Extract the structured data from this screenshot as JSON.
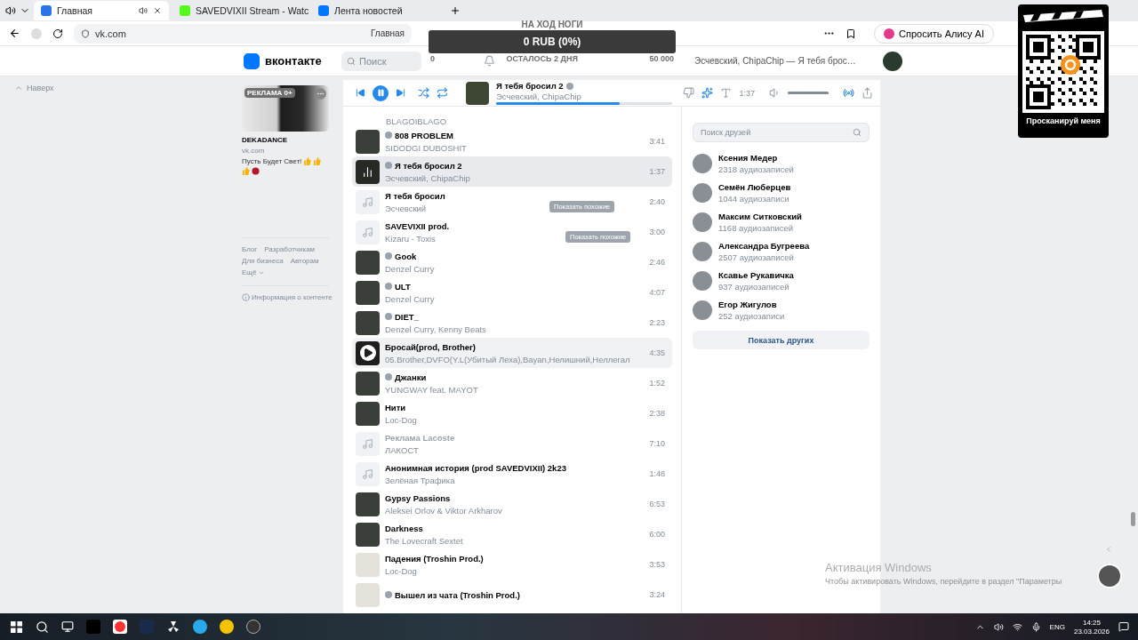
{
  "browser": {
    "tabs": [
      {
        "kind": "video",
        "title": "Главная",
        "selected": true,
        "audio": true
      },
      {
        "kind": "stream",
        "title": "SAVEDVIXII Stream - Watc",
        "selected": false,
        "audio": false
      },
      {
        "kind": "vk",
        "title": "Лента новостей",
        "selected": false,
        "audio": false
      }
    ],
    "url": "vk.com",
    "page_title": "Главная",
    "assistant_button": "Спросить Алису AI"
  },
  "stream_overlay": {
    "caption": "НА ХОД НОГИ",
    "amount": "0 RUB (0%)",
    "remaining": "ОСТАЛОСЬ 2 ДНЯ",
    "start": "0",
    "goal": "50 000",
    "level": 0
  },
  "qr_overlay": {
    "caption": "Просканируй меня"
  },
  "header": {
    "logo": "вконтакте",
    "search_placeholder": "Поиск",
    "now_playing": "Эсчевский, ChipaChip — Я тебя брос…"
  },
  "left_nav": {
    "back_to_top": "Наверх"
  },
  "ad": {
    "badge": "РЕКЛАМА 0+",
    "title": "DEKADANCE",
    "domain": "vk.com",
    "text": "Пусть Будет Свет!"
  },
  "footer_links": [
    "Блог",
    "Разработчикам",
    "Для бизнеса",
    "Авторам"
  ],
  "footer_more": "Ещё",
  "content_info": "Информация о контенте",
  "player": {
    "title": "Я тебя бросил 2",
    "artist": "Эсчевский, ChipaChip",
    "explicit": true,
    "playing": true,
    "time": "1:37",
    "progress": {
      "level": 0.7
    },
    "volume": {
      "level": 1
    }
  },
  "tracks": [
    {
      "kind": "partial",
      "artist": "BLAGOIBLAGO"
    },
    {
      "kind": "photo",
      "title": "808 PROBLEM",
      "artist": "SIDODGI DUBOSHIT",
      "time": "3:41",
      "explicit": true,
      "selected": false,
      "hovered": false,
      "disabled": false
    },
    {
      "kind": "playing",
      "title": "Я тебя бросил 2",
      "artist": "Эсчевский, ChipaChip",
      "time": "1:37",
      "explicit": true,
      "selected": true,
      "hovered": false,
      "disabled": false
    },
    {
      "kind": "note",
      "title": "Я тебя бросил",
      "artist": "Эсчевский",
      "time": "2:40",
      "explicit": false,
      "selected": false,
      "hovered": false,
      "disabled": false,
      "tooltip": "Показать похожие"
    },
    {
      "kind": "note",
      "title": "SAVEVIXII prod.",
      "artist": "Kizaru - Toxis",
      "time": "3:00",
      "explicit": false,
      "selected": false,
      "hovered": false,
      "disabled": false,
      "tooltip": "Показать похожие"
    },
    {
      "kind": "photo",
      "title": "Gook",
      "artist": "Denzel Curry",
      "time": "2:46",
      "explicit": true,
      "selected": false,
      "hovered": false,
      "disabled": false
    },
    {
      "kind": "photo",
      "title": "ULT",
      "artist": "Denzel Curry",
      "time": "4:07",
      "explicit": true,
      "selected": false,
      "hovered": false,
      "disabled": false
    },
    {
      "kind": "photo",
      "title": "DIET_",
      "artist": "Denzel Curry, Kenny Beats",
      "time": "2:23",
      "explicit": true,
      "selected": false,
      "hovered": false,
      "disabled": false
    },
    {
      "kind": "play",
      "title": "Бросай(prod, Brother)",
      "artist": "05.Brother,DVFO(Y.L(Убитый Леха),Bayan,Нелишний,Неллегал",
      "time": "4:35",
      "explicit": false,
      "selected": false,
      "hovered": true,
      "disabled": false
    },
    {
      "kind": "photo",
      "title": "Джанки",
      "artist": "YUNGWAY feat. MAYOT",
      "time": "1:52",
      "explicit": true,
      "selected": false,
      "hovered": false,
      "disabled": false
    },
    {
      "kind": "photo",
      "title": "Нити",
      "artist": "Loc-Dog",
      "time": "2:38",
      "explicit": false,
      "selected": false,
      "hovered": false,
      "disabled": false
    },
    {
      "kind": "note",
      "title": "Реклама Lacoste",
      "artist": "ЛАКОСТ",
      "time": "7:10",
      "explicit": false,
      "selected": false,
      "hovered": false,
      "disabled": true
    },
    {
      "kind": "note",
      "title": "Анонимная история (prod SAVEDVIXII) 2k23",
      "artist": "Зелёная Трафика",
      "time": "1:48",
      "explicit": false,
      "selected": false,
      "hovered": false,
      "disabled": false
    },
    {
      "kind": "photo",
      "title": "Gypsy Passions",
      "artist": "Aleksei Orlov & Viktor Arkharov",
      "time": "6:53",
      "explicit": false,
      "selected": false,
      "hovered": false,
      "disabled": false
    },
    {
      "kind": "photo",
      "title": "Darkness",
      "artist": "The Lovecraft Sextet",
      "time": "6:00",
      "explicit": false,
      "selected": false,
      "hovered": false,
      "disabled": false
    },
    {
      "kind": "blank",
      "title": "Падения (Troshin Prod.)",
      "artist": "Loc-Dog",
      "time": "3:53",
      "explicit": false,
      "selected": false,
      "hovered": false,
      "disabled": false
    },
    {
      "kind": "blank",
      "title": "Вышел из чата (Troshin Prod.)",
      "time": "3:24",
      "explicit": true,
      "selected": false,
      "hovered": false,
      "disabled": false
    }
  ],
  "friends": {
    "search_placeholder": "Поиск друзей",
    "items": [
      {
        "name": "Ксения Медер",
        "count": "2318 аудиозаписей"
      },
      {
        "name": "Семён Люберцев",
        "count": "1044 аудиозаписи"
      },
      {
        "name": "Максим Ситковский",
        "count": "1168 аудиозаписей"
      },
      {
        "name": "Александра Бугреева",
        "count": "2507 аудиозаписей"
      },
      {
        "name": "Ксавье Рукавичка",
        "count": "937 аудиозаписей"
      },
      {
        "name": "Егор Жигулов",
        "count": "252 аудиозаписи"
      }
    ],
    "more_button": "Показать других"
  },
  "windows_activation": {
    "title": "Активация Windows",
    "text": "Чтобы активировать Windows, перейдите в раздел \"Параметры"
  },
  "taskbar": {
    "language": "ENG",
    "time": "14:25",
    "date": "23.03.2026"
  }
}
